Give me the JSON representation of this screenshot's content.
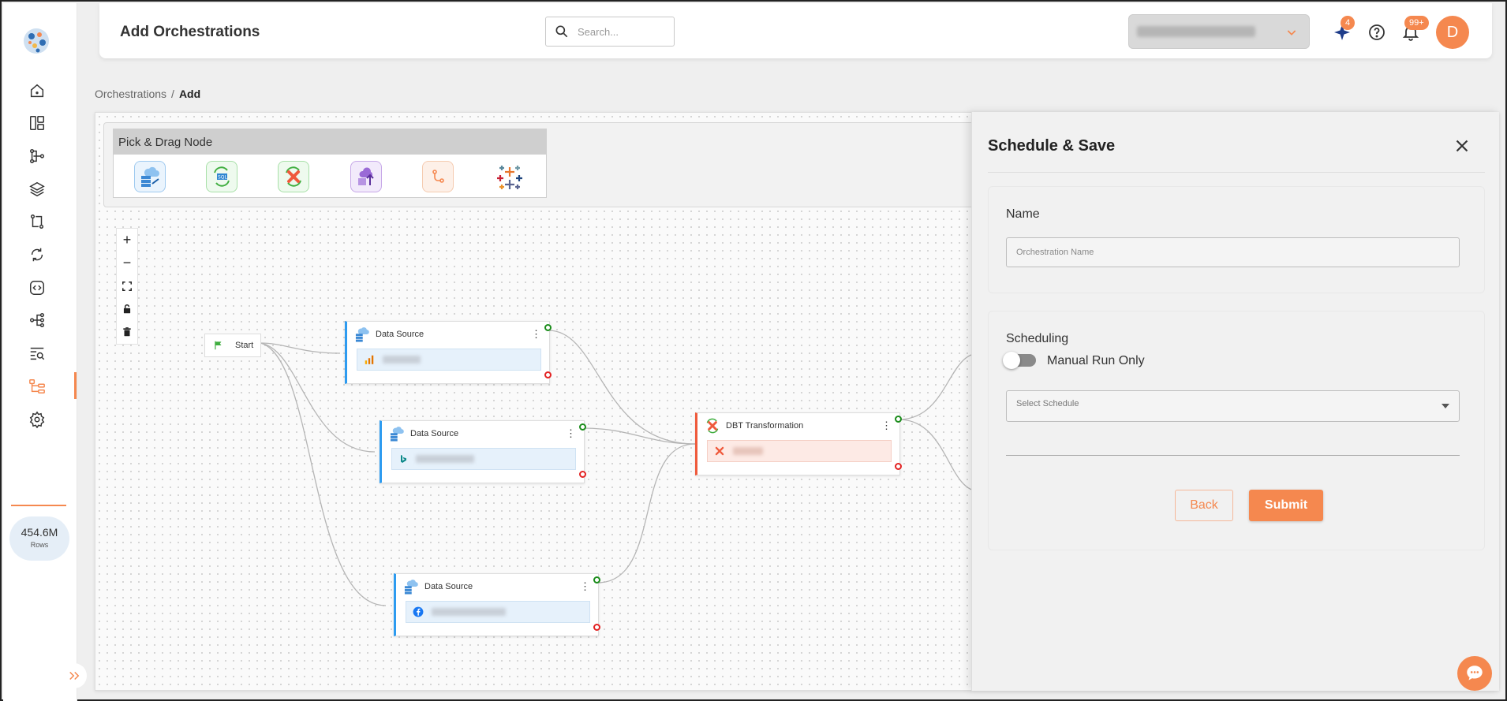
{
  "header": {
    "title": "Add Orchestrations",
    "search_placeholder": "Search...",
    "ai_badge": "4",
    "notif_badge": "99+",
    "avatar_initial": "D"
  },
  "breadcrumb": {
    "parent": "Orchestrations",
    "separator": "/",
    "current": "Add"
  },
  "sidebar": {
    "rows_value": "454.6M",
    "rows_label": "Rows",
    "items": [
      "home-icon",
      "dashboard-icon",
      "pipeline-icon",
      "layers-icon",
      "transform-icon",
      "sync-icon",
      "code-icon",
      "workflow-icon",
      "search-list-icon",
      "orchestration-icon",
      "settings-icon"
    ],
    "accent": "#f5884f"
  },
  "palette": {
    "title": "Pick & Drag Node",
    "items": [
      "data-source-node-icon",
      "sql-node-icon",
      "dbt-node-icon",
      "cloud-upload-node-icon",
      "branch-node-icon",
      "tableau-node-icon"
    ]
  },
  "canvas": {
    "start_label": "Start",
    "nodes": [
      {
        "label": "Data Source",
        "type": "source"
      },
      {
        "label": "Data Source",
        "type": "source"
      },
      {
        "label": "Data Source",
        "type": "source"
      },
      {
        "label": "DBT Transformation",
        "type": "dbt"
      }
    ]
  },
  "panel": {
    "title": "Schedule & Save",
    "name_label": "Name",
    "name_placeholder": "Orchestration Name",
    "name_value": "",
    "scheduling_label": "Scheduling",
    "toggle_label": "Manual Run Only",
    "toggle_on": false,
    "schedule_placeholder": "Select Schedule",
    "back_label": "Back",
    "submit_label": "Submit"
  }
}
